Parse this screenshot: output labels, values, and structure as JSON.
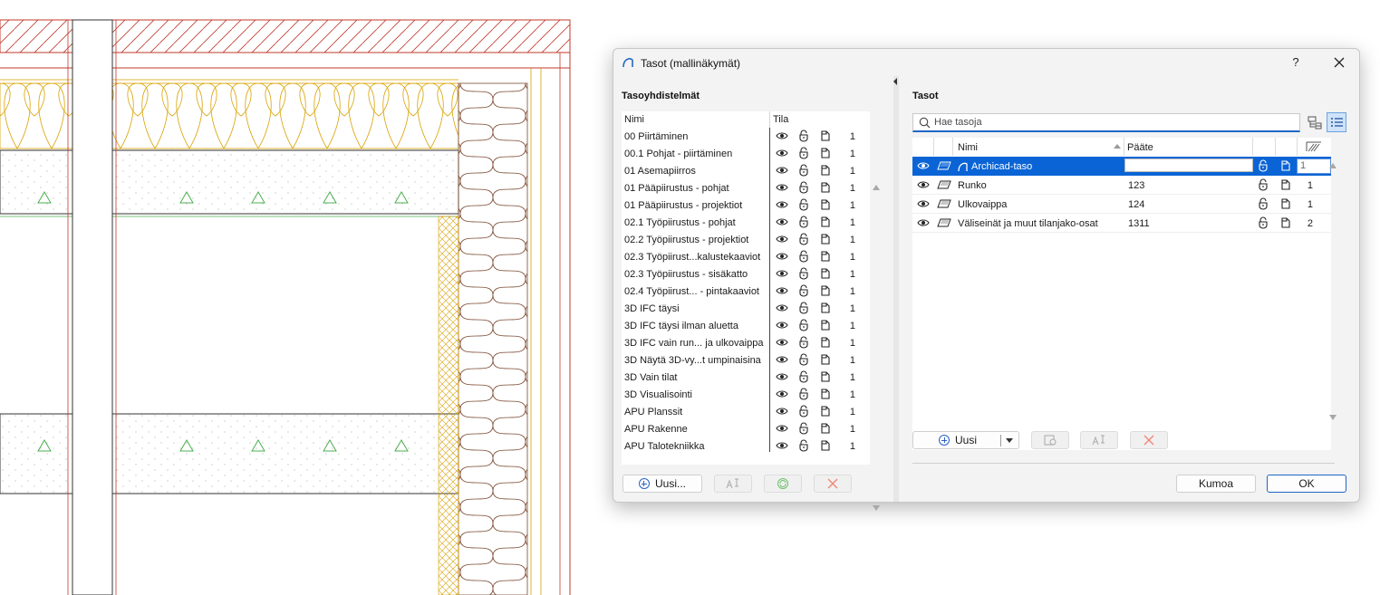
{
  "dialog": {
    "title": "Tasot (mallinäkymät)",
    "help_label": "?"
  },
  "left": {
    "section_title": "Tasoyhdistelmät",
    "columns": {
      "name": "Nimi",
      "state": "Tila"
    },
    "rows": [
      {
        "name": "00 Piirtäminen",
        "count": "1"
      },
      {
        "name": "00.1 Pohjat - piirtäminen",
        "count": "1"
      },
      {
        "name": "01 Asemapiirros",
        "count": "1"
      },
      {
        "name": "01 Pääpiirustus - pohjat",
        "count": "1"
      },
      {
        "name": "01 Pääpiirustus - projektiot",
        "count": "1"
      },
      {
        "name": "02.1 Työpiirustus - pohjat",
        "count": "1"
      },
      {
        "name": "02.2 Työpiirustus - projektiot",
        "count": "1"
      },
      {
        "name": "02.3 Työpiirust...kalustekaaviot",
        "count": "1"
      },
      {
        "name": "02.3 Työpiirustus - sisäkatto",
        "count": "1"
      },
      {
        "name": "02.4 Työpiirust... - pintakaaviot",
        "count": "1"
      },
      {
        "name": "3D IFC täysi",
        "count": "1"
      },
      {
        "name": "3D IFC täysi ilman aluetta",
        "count": "1"
      },
      {
        "name": "3D IFC vain run... ja ulkovaippa",
        "count": "1"
      },
      {
        "name": "3D Näytä 3D-vy...t umpinaisina",
        "count": "1"
      },
      {
        "name": "3D Vain tilat",
        "count": "1"
      },
      {
        "name": "3D Visualisointi",
        "count": "1"
      },
      {
        "name": "APU Planssit",
        "count": "1"
      },
      {
        "name": "APU Rakenne",
        "count": "1"
      },
      {
        "name": "APU Talotekniikka",
        "count": "1"
      }
    ],
    "buttons": {
      "new": "Uusi..."
    }
  },
  "right": {
    "section_title": "Tasot",
    "search_placeholder": "Hae tasoja",
    "columns": {
      "name": "Nimi",
      "ext": "Pääte"
    },
    "rows": [
      {
        "name": "Archicad-taso",
        "ext": "",
        "count": "1",
        "selected": true
      },
      {
        "name": "Runko",
        "ext": "123",
        "count": "1",
        "selected": false
      },
      {
        "name": "Ulkovaippa",
        "ext": "124",
        "count": "1",
        "selected": false
      },
      {
        "name": "Väliseinät ja muut tilanjako-osat",
        "ext": "1311",
        "count": "2",
        "selected": false
      }
    ],
    "buttons": {
      "new": "Uusi",
      "cancel": "Kumoa",
      "ok": "OK"
    }
  },
  "colors": {
    "accent": "#0a64d6",
    "drawing_red": "#c0392b",
    "drawing_insulation": "#d8a100",
    "drawing_mineral": "#7a4a32",
    "drawing_green": "#4caf50"
  },
  "icons": [
    "archicad-icon",
    "close-icon",
    "eye-icon",
    "lock-icon",
    "file-icon",
    "search-icon",
    "folder-tree-icon",
    "list-view-icon",
    "rename-icon",
    "refresh-icon",
    "delete-icon",
    "duplicate-icon",
    "layer-icon"
  ]
}
